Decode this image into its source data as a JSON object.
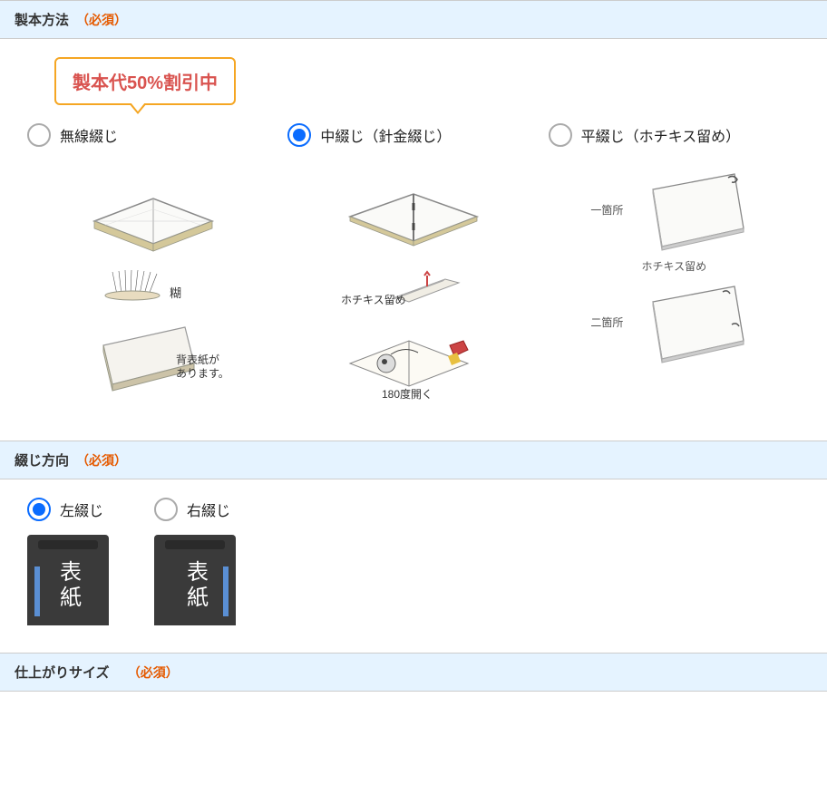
{
  "sections": {
    "binding_method": {
      "title": "製本方法",
      "required_label": "（必須）"
    },
    "binding_direction": {
      "title": "綴じ方向",
      "required_label": "（必須）"
    },
    "finish_size": {
      "title": "仕上がりサイズ",
      "required_label": "（必須）"
    }
  },
  "promo": {
    "text": "製本代50%割引中"
  },
  "binding_options": [
    {
      "label": "無線綴じ",
      "selected": false,
      "illus": {
        "glue_label": "糊",
        "spine_line1": "背表紙が",
        "spine_line2": "あります。"
      }
    },
    {
      "label": "中綴じ（針金綴じ）",
      "selected": true,
      "illus": {
        "staple_label": "ホチキス留め",
        "open_label": "180度開く"
      }
    },
    {
      "label": "平綴じ（ホチキス留め）",
      "selected": false,
      "illus": {
        "one_place": "一箇所",
        "two_place": "二箇所",
        "staple_label": "ホチキス留め"
      }
    }
  ],
  "direction_options": [
    {
      "label": "左綴じ",
      "selected": true,
      "cover_text": "表紙"
    },
    {
      "label": "右綴じ",
      "selected": false,
      "cover_text": "表紙"
    }
  ]
}
